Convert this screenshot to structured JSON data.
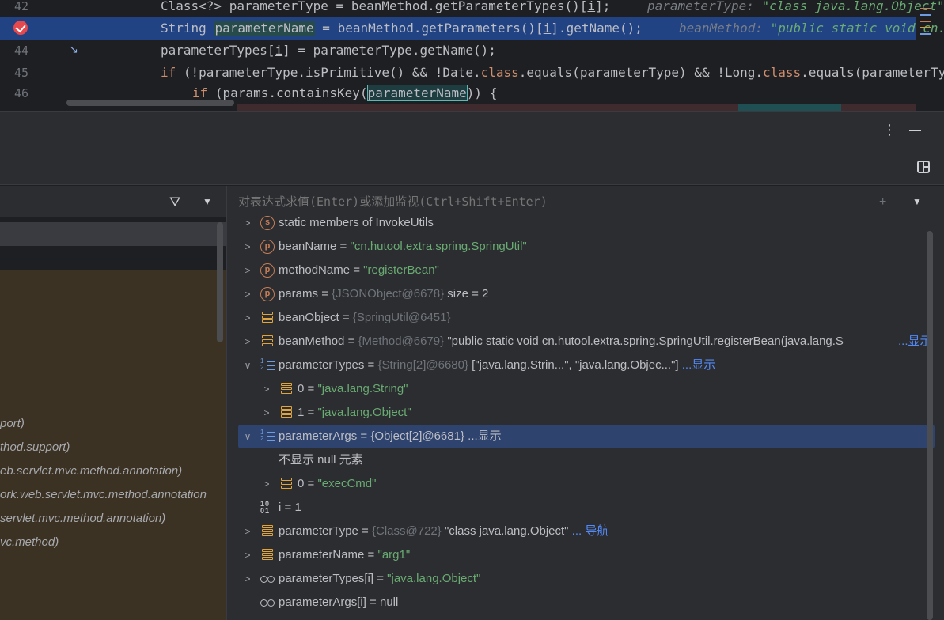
{
  "editor": {
    "lines": [
      {
        "num": "42",
        "pre": "Class<?> parameterType = beanMethod.getParameterTypes()[",
        "i": "i",
        "post": "];",
        "hint_label": "parameterType:",
        "hint_value": "\"class java.lang.Object\""
      },
      {
        "num": "",
        "pre": "String ",
        "hl": "parameterName",
        "post": " = beanMethod.getParameters()[",
        "i": "i",
        "post2": "].getName();",
        "hint_label": "beanMethod:",
        "hint_value": "\"public static void cn.hutool\""
      },
      {
        "num": "44",
        "pre": "parameterTypes[",
        "i": "i",
        "post": "] = parameterType.getName();"
      },
      {
        "num": "45",
        "kw": "if",
        "mid": " (!parameterType.isPrimitive() && !Date.",
        "kw2": "class",
        "mid2": ".equals(parameterType) && !Long.",
        "kw3": "class",
        "post": ".equals(parameterType)"
      },
      {
        "num": "46",
        "kw": "if",
        "pre": " (params.containsKey(",
        "hl": "parameterName",
        "post": ")) {"
      }
    ]
  },
  "toolwindow": {
    "more_glyph": "⋮"
  },
  "frames": {
    "rows": [
      "port)",
      "thod.support)",
      "eb.servlet.mvc.method.annotation)",
      "ork.web.servlet.mvc.method.annotation",
      "servlet.mvc.method.annotation)",
      "vc.method)"
    ]
  },
  "variables": {
    "eval_placeholder": "对表达式求值(Enter)或添加监视(Ctrl+Shift+Enter)",
    "rows": [
      {
        "name": "static members of InvokeUtils",
        "eq": "",
        "ref": "",
        "value": "",
        "extra": "",
        "link": ""
      },
      {
        "name": "beanName",
        "eq": " = ",
        "ref": "",
        "value": "\"cn.hutool.extra.spring.SpringUtil\"",
        "extra": "",
        "link": ""
      },
      {
        "name": "methodName",
        "eq": " = ",
        "ref": "",
        "value": "\"registerBean\"",
        "extra": "",
        "link": ""
      },
      {
        "name": "params",
        "eq": " = ",
        "ref": "{JSONObject@6678}",
        "value": "",
        "extra": " size = 2",
        "link": ""
      },
      {
        "name": "beanObject",
        "eq": " = ",
        "ref": "{SpringUtil@6451}",
        "value": "",
        "extra": "",
        "link": ""
      },
      {
        "name": "beanMethod",
        "eq": " = ",
        "ref": "{Method@6679}",
        "value": "",
        "extra": " \"public static void cn.hutool.extra.spring.SpringUtil.registerBean(java.lang.S",
        "link": "...显示"
      },
      {
        "name": "parameterTypes",
        "eq": " = ",
        "ref": "{String[2]@6680}",
        "value": "",
        "extra": " [\"java.lang.Strin...\", \"java.lang.Objec...\"]",
        "link": " ...显示"
      },
      {
        "name": "0",
        "eq": " = ",
        "ref": "",
        "value": "\"java.lang.String\"",
        "extra": "",
        "link": ""
      },
      {
        "name": "1",
        "eq": " = ",
        "ref": "",
        "value": "\"java.lang.Object\"",
        "extra": "",
        "link": ""
      },
      {
        "name": "parameterArgs",
        "eq": " = ",
        "ref": "",
        "value": "",
        "extra": "{Object[2]@6681}",
        "link": "  ...显示"
      },
      {
        "name": "不显示 null 元素",
        "eq": "",
        "ref": "",
        "value": "",
        "extra": "",
        "link": ""
      },
      {
        "name": "0",
        "eq": " = ",
        "ref": "",
        "value": "\"execCmd\"",
        "extra": "",
        "link": ""
      },
      {
        "name": "i",
        "eq": " = ",
        "ref": "",
        "value": "",
        "extra": "1",
        "link": ""
      },
      {
        "name": "parameterType",
        "eq": " = ",
        "ref": "{Class@722}",
        "value": "",
        "extra": " \"class java.lang.Object\"",
        "link": " ... 导航"
      },
      {
        "name": "parameterName",
        "eq": " = ",
        "ref": "",
        "value": "\"arg1\"",
        "extra": "",
        "link": ""
      },
      {
        "name": "parameterTypes[i]",
        "eq": " = ",
        "ref": "",
        "value": "\"java.lang.Object\"",
        "extra": "",
        "link": ""
      },
      {
        "name": "parameterArgs[i]",
        "eq": " = ",
        "ref": "",
        "value": "",
        "extra": "null",
        "link": ""
      }
    ]
  },
  "colors": {
    "breakpoint": "#e5484d",
    "selection": "#214283",
    "string_value": "#6aab73",
    "link": "#548af7",
    "keyword": "#cf8e6d"
  }
}
